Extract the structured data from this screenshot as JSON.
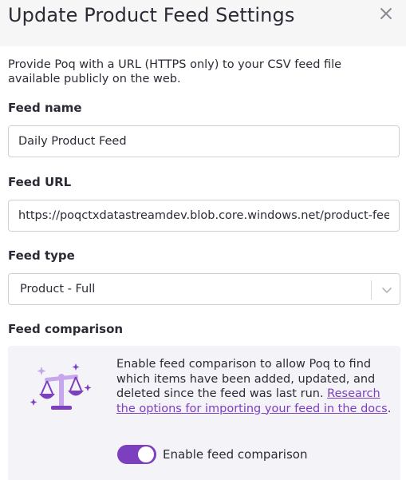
{
  "dialog": {
    "title": "Update Product Feed Settings",
    "description": "Provide Poq with a URL (HTTPS only) to your CSV feed file available publicly on the web."
  },
  "fields": {
    "feed_name": {
      "label": "Feed name",
      "value": "Daily Product Feed"
    },
    "feed_url": {
      "label": "Feed URL",
      "value": "https://poqctxdatastreamdev.blob.core.windows.net/product-feeds/daily.csv"
    },
    "feed_type": {
      "label": "Feed type",
      "selected": "Product - Full"
    },
    "feed_comparison": {
      "label": "Feed comparison",
      "text": "Enable feed comparison to allow Poq to find which items have been added, updated, and deleted since the feed was last run.",
      "link_text": "Research the options for importing your feed in the docs",
      "after_link": ".",
      "toggle_label": "Enable feed comparison",
      "toggle_on": true
    }
  },
  "icons": {
    "close": "close-icon",
    "dropdown": "chevron-down-icon",
    "illustration": "scales-sparkle-icon"
  },
  "colors": {
    "accent": "#7b3fbf",
    "header_bg": "#f6f6f6",
    "panel_bg": "#f4f3f8",
    "illustration_light": "#c6a6ec"
  }
}
